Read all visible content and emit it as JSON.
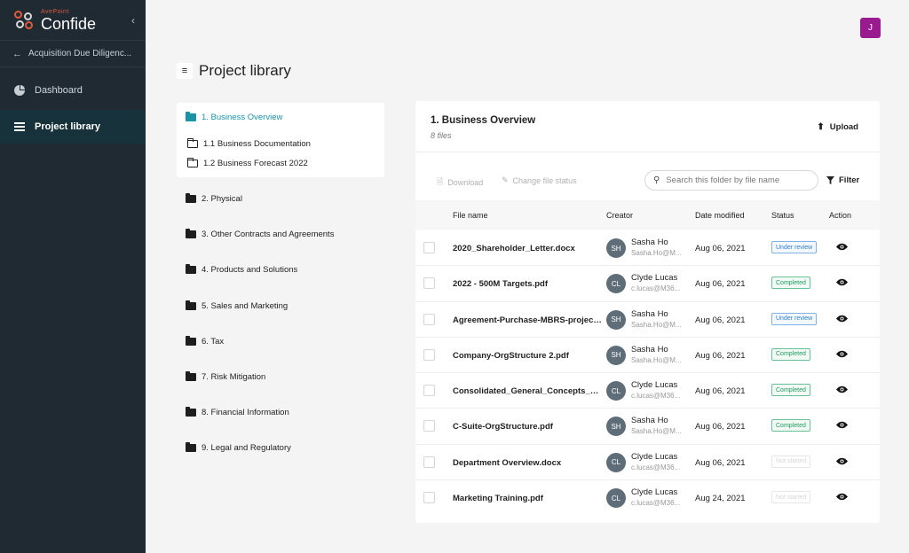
{
  "brand": {
    "small": "AvePoint",
    "name": "Confide"
  },
  "sidebar": {
    "back_label": "Acquisition Due Diligenc...",
    "items": [
      {
        "label": "Dashboard",
        "icon": "pie-chart-icon"
      },
      {
        "label": "Project library",
        "icon": "list-icon"
      }
    ]
  },
  "user": {
    "initial": "J",
    "color": "#9a1a8f"
  },
  "page": {
    "title": "Project library"
  },
  "tree": {
    "active": "1. Business Overview",
    "subfolders": [
      "1.1 Business Documentation",
      "1.2 Business Forecast 2022"
    ],
    "folders": [
      "2. Physical",
      "3. Other Contracts and Agreements",
      "4. Products and Solutions",
      "5. Sales and Marketing",
      "6. Tax",
      "7. Risk Mitigation",
      "8. Financial Information",
      "9. Legal and Regulatory"
    ]
  },
  "panel": {
    "folder_title": "1. Business Overview",
    "file_count": "8 files",
    "upload_label": "Upload",
    "download_label": "Download",
    "change_status_label": "Change file status",
    "search_placeholder": "Search this folder by file name",
    "filter_label": "Filter",
    "columns": [
      "File name",
      "Creator",
      "Date modified",
      "Status",
      "Action"
    ]
  },
  "files": [
    {
      "name": "2020_Shareholder_Letter.docx",
      "initials": "SH",
      "creator": "Sasha Ho",
      "email": "Sasha.Ho@M...",
      "date": "Aug 06, 2021",
      "status": "Under review",
      "status_type": "review"
    },
    {
      "name": "2022 - 500M Targets.pdf",
      "initials": "CL",
      "creator": "Clyde Lucas",
      "email": "c.lucas@M36...",
      "date": "Aug 06, 2021",
      "status": "Completed",
      "status_type": "completed"
    },
    {
      "name": "Agreement-Purchase-MBRS-project ...",
      "initials": "SH",
      "creator": "Sasha Ho",
      "email": "Sasha.Ho@M...",
      "date": "Aug 06, 2021",
      "status": "Under review",
      "status_type": "review"
    },
    {
      "name": "Company-OrgStructure 2.pdf",
      "initials": "SH",
      "creator": "Sasha Ho",
      "email": "Sasha.Ho@M...",
      "date": "Aug 06, 2021",
      "status": "Completed",
      "status_type": "completed"
    },
    {
      "name": "Consolidated_General_Concepts_Par...",
      "initials": "CL",
      "creator": "Clyde Lucas",
      "email": "c.lucas@M36...",
      "date": "Aug 06, 2021",
      "status": "Completed",
      "status_type": "completed"
    },
    {
      "name": "C-Suite-OrgStructure.pdf",
      "initials": "SH",
      "creator": "Sasha Ho",
      "email": "Sasha.Ho@M...",
      "date": "Aug 06, 2021",
      "status": "Completed",
      "status_type": "completed"
    },
    {
      "name": "Department Overview.docx",
      "initials": "CL",
      "creator": "Clyde Lucas",
      "email": "c.lucas@M36...",
      "date": "Aug 06, 2021",
      "status": "Not started",
      "status_type": "notstarted"
    },
    {
      "name": "Marketing Training.pdf",
      "initials": "CL",
      "creator": "Clyde Lucas",
      "email": "c.lucas@M36...",
      "date": "Aug 24, 2021",
      "status": "Not started",
      "status_type": "notstarted"
    }
  ]
}
